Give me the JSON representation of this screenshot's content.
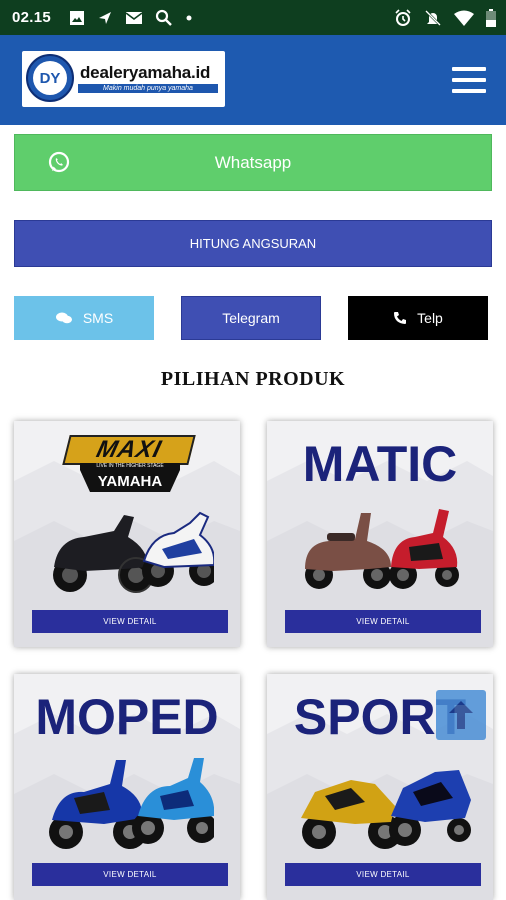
{
  "status_bar": {
    "time": "02.15"
  },
  "header": {
    "logo_initials": "DY",
    "logo_name": "dealeryamaha.id",
    "logo_tagline": "Makin mudah punya yamaha"
  },
  "buttons": {
    "whatsapp": "Whatsapp",
    "hitung": "HITUNG ANGSURAN",
    "sms": "SMS",
    "telegram": "Telegram",
    "telp": "Telp"
  },
  "section_title": "PILIHAN PRODUK",
  "products": [
    {
      "title": "MAXI",
      "brand": "YAMAHA",
      "slogan": "LIVE IN THE HIGHER STAGE",
      "button": "VIEW DETAIL"
    },
    {
      "title": "MATIC",
      "button": "VIEW DETAIL"
    },
    {
      "title": "MOPED",
      "button": "VIEW DETAIL"
    },
    {
      "title": "SPORT",
      "button": "VIEW DETAIL"
    }
  ],
  "colors": {
    "status_bar": "#0e3e1f",
    "header": "#1e5ab0",
    "whatsapp": "#5fce6c",
    "primary": "#3f4fb3",
    "sms": "#6cc2e9",
    "telp": "#000000",
    "view_button": "#2a2f9c"
  },
  "icons": [
    "image-icon",
    "navigation-icon",
    "mail-icon",
    "search-icon",
    "dot-icon",
    "alarm-icon",
    "notifications-off-icon",
    "wifi-icon",
    "battery-icon",
    "whatsapp-icon",
    "chat-icon",
    "phone-icon",
    "menu-icon",
    "arrow-up-icon"
  ]
}
